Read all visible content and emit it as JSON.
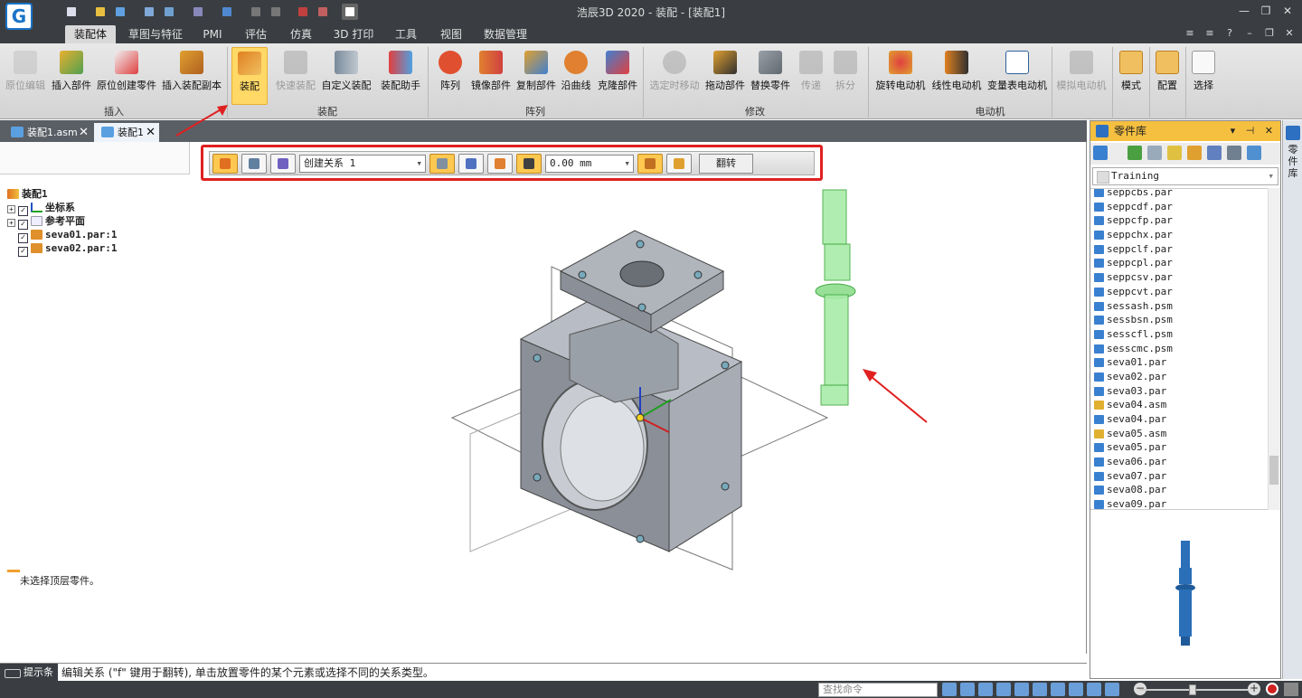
{
  "app": {
    "logo": "G",
    "title": "浩辰3D 2020 - 装配 - [装配1]"
  },
  "ribbon_tabs": [
    "装配体",
    "草图与特征",
    "PMI",
    "评估",
    "仿真",
    "3D 打印",
    "工具",
    "视图",
    "数据管理"
  ],
  "ribbon": {
    "buttons": [
      "原位编辑",
      "插入部件",
      "原位创建零件",
      "插入装配副本",
      "装配",
      "快速装配",
      "自定义装配",
      "装配助手",
      "阵列",
      "镜像部件",
      "复制部件",
      "沿曲线",
      "克隆部件",
      "选定时移动",
      "拖动部件",
      "替换零件",
      "传递",
      "拆分",
      "旋转电动机",
      "线性电动机",
      "变量表电动机",
      "模拟电动机",
      "模式",
      "配置",
      "选择"
    ],
    "groups": [
      "插入",
      "装配",
      "阵列",
      "修改",
      "电动机"
    ]
  },
  "doc_tabs": [
    "装配1.asm",
    "装配1"
  ],
  "tree": {
    "root": "装配1",
    "items": [
      "坐标系",
      "参考平面",
      "seva01.par:1",
      "seva02.par:1"
    ]
  },
  "left_status": "未选择顶层零件。",
  "command_bar": {
    "relation_value": "创建关系 1",
    "offset_value": "0.00 mm",
    "flip_label": "翻转"
  },
  "parts_library": {
    "title": "零件库",
    "folder": "Training",
    "items": [
      "seppcbs.par",
      "seppcdf.par",
      "seppcfp.par",
      "seppchx.par",
      "seppclf.par",
      "seppcpl.par",
      "seppcsv.par",
      "seppcvt.par",
      "sessash.psm",
      "sessbsn.psm",
      "sesscfl.psm",
      "sesscmc.psm",
      "seva01.par",
      "seva02.par",
      "seva03.par",
      "seva04.asm",
      "seva04.par",
      "seva05.asm",
      "seva05.par",
      "seva06.par",
      "seva07.par",
      "seva08.par",
      "seva09.par"
    ],
    "side_tab_label": "零件库"
  },
  "prompt": {
    "label": "提示条",
    "text": "编辑关系 (\"f\" 键用于翻转), 单击放置零件的某个元素或选择不同的关系类型。"
  },
  "statusbar": {
    "search_placeholder": "查找命令"
  },
  "colors": {
    "titlebar": "#3a3e42",
    "accent_orange": "#f5c040",
    "highlight_red": "#e02020",
    "part_green": "#90e890",
    "part_blue": "#2a6fb8"
  }
}
